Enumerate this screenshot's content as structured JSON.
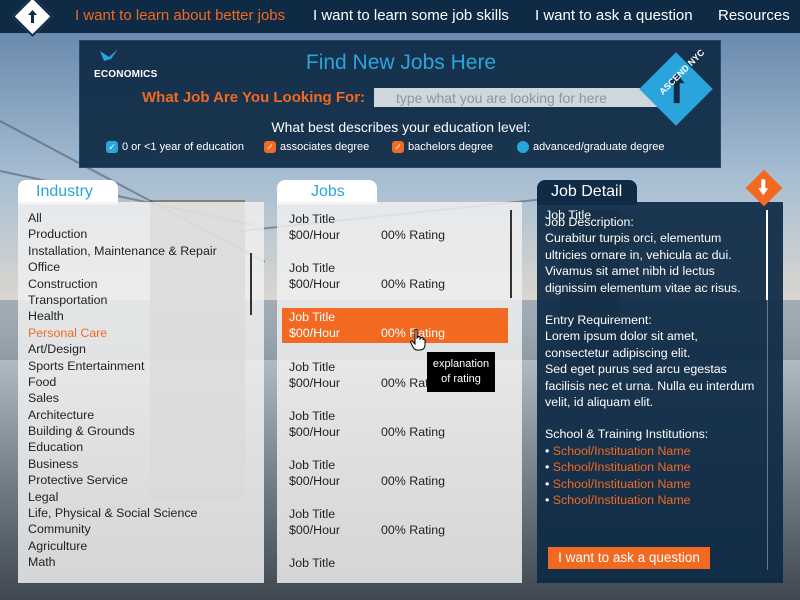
{
  "nav": {
    "items": [
      {
        "label": "I want to learn about better jobs",
        "active": true
      },
      {
        "label": "I want to learn some job skills",
        "active": false
      },
      {
        "label": "I want to ask a question",
        "active": false
      },
      {
        "label": "Resources",
        "active": false
      }
    ]
  },
  "header": {
    "partner_logo_text": "ECONOMICS",
    "title": "Find New Jobs Here",
    "brand_logo_text": "ASCEND NYC",
    "search_label": "What Job Are You Looking For:",
    "search_placeholder": "type what you are looking for here",
    "education_question": "What best describes your education level:",
    "education_options": [
      {
        "label": "0 or <1 year of education",
        "state": "checked-blue"
      },
      {
        "label": "associates degree",
        "state": "checked-orange"
      },
      {
        "label": "bachelors degree",
        "state": "checked-orange"
      },
      {
        "label": "advanced/graduate degree",
        "state": "unchecked"
      }
    ]
  },
  "industry": {
    "tab_label": "Industry",
    "items": [
      "All",
      "Production",
      "Installation, Maintenance & Repair",
      "Office",
      "Construction",
      "Transportation",
      "Health",
      "Personal Care",
      "Art/Design",
      "Sports Entertainment",
      "Food",
      "Sales",
      "Architecture",
      "Building & Grounds",
      "Education",
      "Business",
      "Protective Service",
      "Legal",
      "Life, Physical & Social Science",
      "Community",
      "Agriculture",
      "Math"
    ],
    "selected": "Personal Care"
  },
  "jobs": {
    "tab_label": "Jobs",
    "items": [
      {
        "title": "Job Title",
        "pay": "$00/Hour",
        "rating": "00% Rating",
        "active": false
      },
      {
        "title": "Job Title",
        "pay": "$00/Hour",
        "rating": "00% Rating",
        "active": false
      },
      {
        "title": "Job Title",
        "pay": "$00/Hour",
        "rating": "00% Rating",
        "active": true
      },
      {
        "title": "Job Title",
        "pay": "$00/Hour",
        "rating": "00% Rat",
        "active": false
      },
      {
        "title": "Job Title",
        "pay": "$00/Hour",
        "rating": "00% Rating",
        "active": false
      },
      {
        "title": "Job Title",
        "pay": "$00/Hour",
        "rating": "00% Rating",
        "active": false
      },
      {
        "title": "Job Title",
        "pay": "$00/Hour",
        "rating": "00% Rating",
        "active": false
      },
      {
        "title": "Job Title",
        "pay": "",
        "rating": "",
        "active": false
      }
    ],
    "tooltip_line1": "explanation",
    "tooltip_line2": "of rating"
  },
  "detail": {
    "tab_label": "Job Detail",
    "overlap_title": "Job Title",
    "description_heading": "Job Description:",
    "description_text": "Curabitur turpis orci, elementum ultricies ornare in, vehicula ac dui. Vivamus sit amet nibh id lectus dignissim elementum vitae ac risus.",
    "requirement_heading": "Entry Requirement:",
    "requirement_text_1": "Lorem ipsum dolor sit amet, consectetur adipiscing elit.",
    "requirement_text_2": "Sed eget purus sed arcu egestas facilisis nec et urna. Nulla eu interdum velit, id aliquam elit.",
    "schools_heading": "School & Training Institutions:",
    "schools": [
      "School/Instituation Name",
      "School/Instituation Name",
      "School/Instituation Name",
      "School/Instituation Name"
    ],
    "ask_button": "I want to ask a question"
  },
  "colors": {
    "navy": "#0e2a45",
    "accent_orange": "#f26a21",
    "accent_blue": "#29a5dc"
  }
}
